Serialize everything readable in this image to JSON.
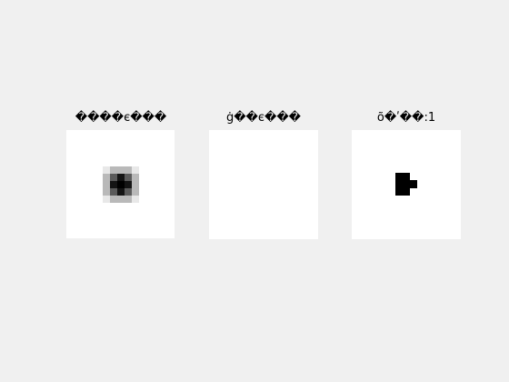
{
  "figure": {
    "panels": [
      {
        "id": "blurred",
        "title": "����є���",
        "content": "blurred-dark-blob"
      },
      {
        "id": "blank",
        "title": "ġ��є���",
        "content": "empty"
      },
      {
        "id": "binary",
        "title": "õ�ʹ��:1",
        "content": "black-block-shape"
      }
    ],
    "colors": {
      "background": "#f0f0f0",
      "panel": "#ffffff",
      "ink": "#000000"
    }
  }
}
